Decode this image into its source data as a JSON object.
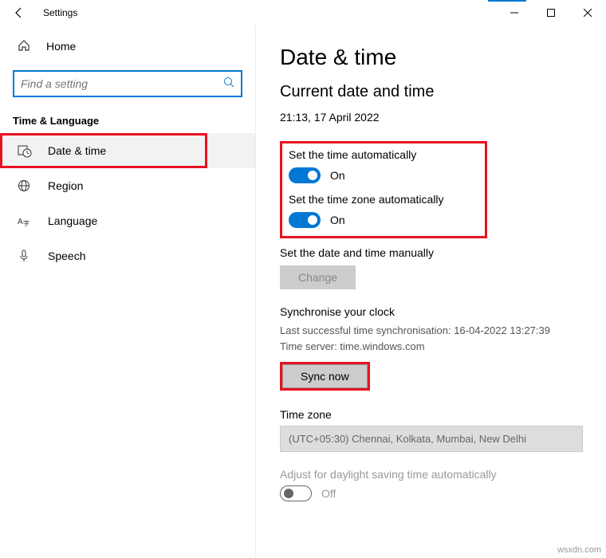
{
  "titlebar": {
    "title": "Settings"
  },
  "sidebar": {
    "home": "Home",
    "search_placeholder": "Find a setting",
    "section": "Time & Language",
    "items": [
      {
        "label": "Date & time"
      },
      {
        "label": "Region"
      },
      {
        "label": "Language"
      },
      {
        "label": "Speech"
      }
    ]
  },
  "main": {
    "heading": "Date & time",
    "subheading": "Current date and time",
    "current": "21:13, 17 April 2022",
    "auto_time_label": "Set the time automatically",
    "auto_time_state": "On",
    "auto_tz_label": "Set the time zone automatically",
    "auto_tz_state": "On",
    "manual_label": "Set the date and time manually",
    "change_btn": "Change",
    "sync_heading": "Synchronise your clock",
    "sync_last": "Last successful time synchronisation: 16-04-2022 13:27:39",
    "sync_server": "Time server: time.windows.com",
    "sync_btn": "Sync now",
    "tz_heading": "Time zone",
    "tz_value": "(UTC+05:30) Chennai, Kolkata, Mumbai, New Delhi",
    "dst_label": "Adjust for daylight saving time automatically",
    "dst_state": "Off"
  },
  "watermark": "wsxdn.com"
}
